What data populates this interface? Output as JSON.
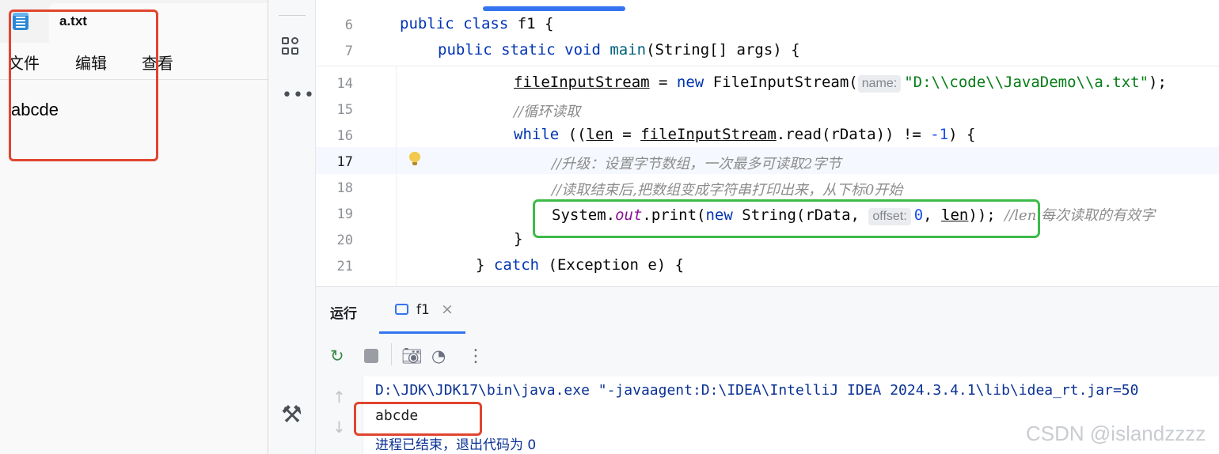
{
  "notepad": {
    "tab_title": "a.txt",
    "menu": [
      "文件",
      "编辑",
      "查看"
    ],
    "content": "abcde"
  },
  "ide": {
    "code_lines": [
      {
        "num": "6",
        "text": "public class f1 {"
      },
      {
        "num": "7",
        "text": "public static void main(String[] args) {"
      },
      {
        "num": "14",
        "pre": "fileInputStream",
        "mid": " = ",
        "kw": "new",
        "call": " FileInputStream(",
        "hint": "name:",
        "str": "\"D:\\\\code\\\\JavaDemo\\\\a.txt\"",
        "end": ");"
      },
      {
        "num": "15",
        "comment": "//循环读取"
      },
      {
        "num": "16",
        "kw": "while",
        "a": " ((",
        "var": "len",
        "b": " = ",
        "obj": "fileInputStream",
        "c": ".read(rData)) != ",
        "numv": "-1",
        "d": ") {"
      },
      {
        "num": "17",
        "comment": "//升级：设置字节数组，一次最多可读取2字节"
      },
      {
        "num": "18",
        "comment": "//读取结束后,把数组变成字符串打印出来，从下标0开始"
      },
      {
        "num": "19",
        "a": "System.",
        "field": "out",
        "b": ".print(",
        "kw": "new",
        "c": " String(rData, ",
        "hint": "offset:",
        "numv": "0",
        "d": ", ",
        "var": "len",
        "e": "));",
        "comment": "//len 每次读取的有效字"
      },
      {
        "num": "20",
        "text": "}"
      },
      {
        "num": "21",
        "text": "} catch (Exception e) {"
      }
    ],
    "run_panel": {
      "title": "运行",
      "tab_label": "f1",
      "close_glyph": "×",
      "console": {
        "command": "D:\\JDK\\JDK17\\bin\\java.exe \"-javaagent:D:\\IDEA\\IntelliJ IDEA 2024.3.4.1\\lib\\idea_rt.jar=50",
        "output": "abcde",
        "exit": "进程已结束，退出代码为 0"
      }
    }
  },
  "watermark": "CSDN @islandzzzz",
  "colors": {
    "keyword": "#0033b3",
    "string": "#067d17",
    "number": "#1750eb",
    "comment": "#8c8c8c",
    "accent": "#3574f0",
    "red_box": "#e0452f",
    "green_box": "#3dbb4a"
  }
}
